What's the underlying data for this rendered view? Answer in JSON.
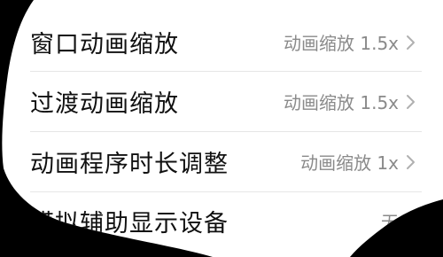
{
  "colors": {
    "background_outside": "#000000",
    "panel": "#ffffff",
    "label_text": "#111111",
    "value_text": "#8a8a8a",
    "chevron": "#b0b0b0",
    "divider": "#e6e6e6"
  },
  "settings": {
    "rows": [
      {
        "label": "窗口动画缩放",
        "value": "动画缩放 1.5x",
        "icon": "chevron-right-icon"
      },
      {
        "label": "过渡动画缩放",
        "value": "动画缩放 1.5x",
        "icon": "chevron-right-icon"
      },
      {
        "label": "动画程序时长调整",
        "value": "动画缩放 1x",
        "icon": "chevron-right-icon"
      },
      {
        "label": "模拟辅助显示设备",
        "value": "无",
        "icon": "chevron-right-icon"
      }
    ]
  }
}
